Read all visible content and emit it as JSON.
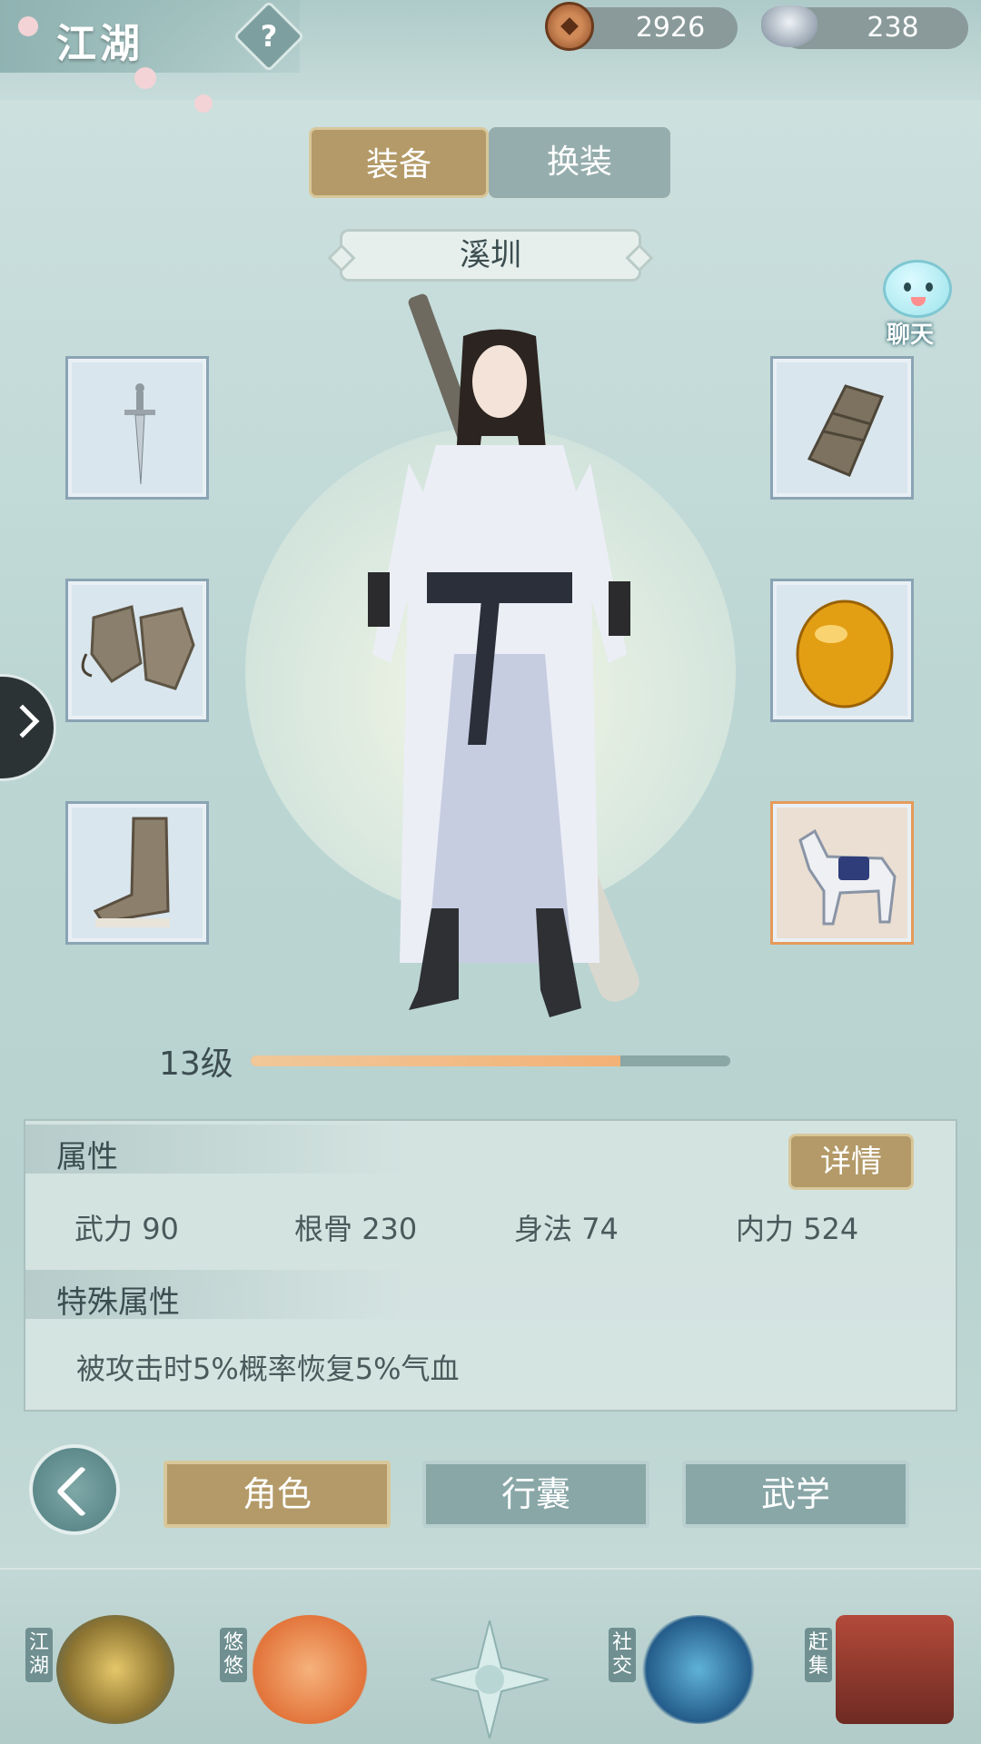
{
  "header": {
    "title": "江湖",
    "help_label": "?",
    "currencies": [
      {
        "icon": "copper-coin-icon",
        "value": "2926"
      },
      {
        "icon": "silver-ingot-icon",
        "value": "238"
      }
    ]
  },
  "tabs": [
    {
      "label": "装备",
      "active": true
    },
    {
      "label": "换装",
      "active": false
    }
  ],
  "character": {
    "name": "溪圳",
    "level_label": "13级",
    "level_progress": 0.77
  },
  "chat": {
    "label": "聊天"
  },
  "equipment": {
    "left": [
      {
        "icon": "sword-icon"
      },
      {
        "icon": "gauntlets-icon"
      },
      {
        "icon": "boot-icon"
      }
    ],
    "right": [
      {
        "icon": "bracer-icon"
      },
      {
        "icon": "amber-gem-icon"
      },
      {
        "icon": "horse-icon"
      }
    ]
  },
  "attributes": {
    "section_title": "属性",
    "detail_button": "详情",
    "stats": [
      {
        "name": "武力",
        "value": "90"
      },
      {
        "name": "根骨",
        "value": "230"
      },
      {
        "name": "身法",
        "value": "74"
      },
      {
        "name": "内力",
        "value": "524"
      }
    ],
    "special_title": "特殊属性",
    "special_text": "被攻击时5%概率恢复5%气血"
  },
  "bottom_tabs": [
    {
      "label": "角色",
      "active": true
    },
    {
      "label": "行囊",
      "active": false
    },
    {
      "label": "武学",
      "active": false
    }
  ],
  "dock": [
    {
      "label": "江湖"
    },
    {
      "label": "悠悠"
    },
    {
      "label": ""
    },
    {
      "label": "社交"
    },
    {
      "label": "赶集"
    }
  ],
  "colors": {
    "accent_gold": "#b39a68",
    "tab_inactive": "#8aa7a8",
    "level_fill": "#f2b176"
  }
}
